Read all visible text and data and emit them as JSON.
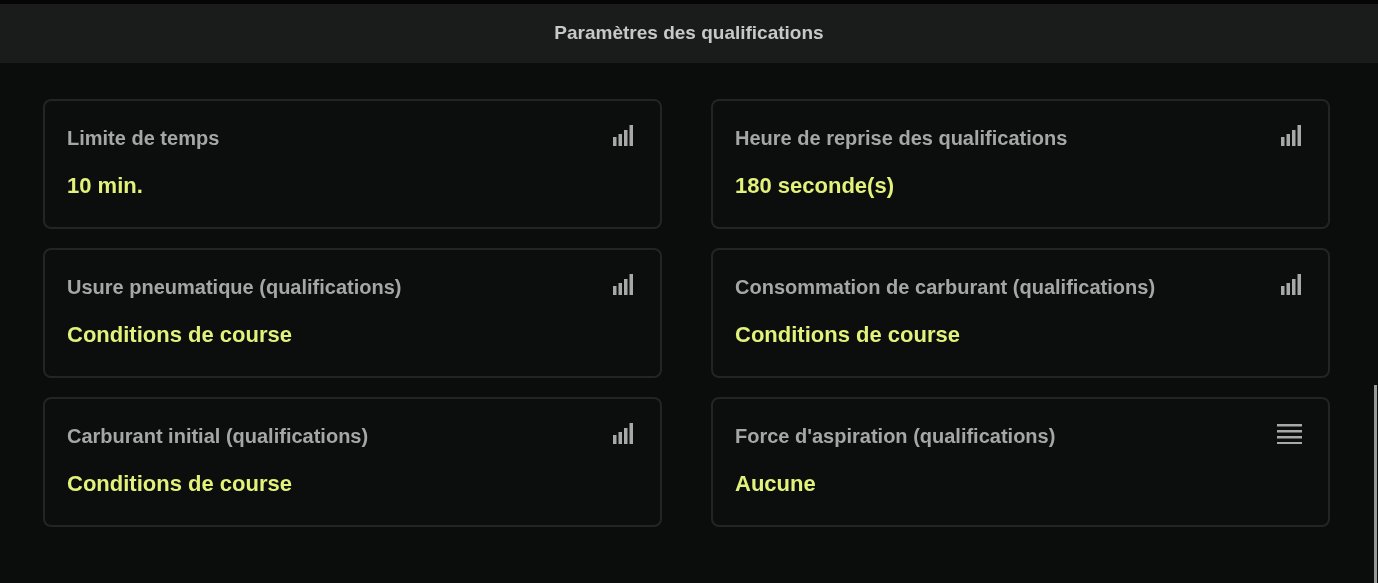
{
  "header": {
    "title": "Paramètres des qualifications"
  },
  "settings": [
    {
      "label": "Limite de temps",
      "value": "10 min.",
      "kind": "bars"
    },
    {
      "label": "Heure de reprise des qualifications",
      "value": "180 seconde(s)",
      "kind": "bars"
    },
    {
      "label": "Usure pneumatique (qualifications)",
      "value": "Conditions de course",
      "kind": "bars"
    },
    {
      "label": "Consommation de carburant (qualifications)",
      "value": "Conditions de course",
      "kind": "bars"
    },
    {
      "label": "Carburant initial (qualifications)",
      "value": "Conditions de course",
      "kind": "bars"
    },
    {
      "label": "Force d'aspiration (qualifications)",
      "value": "Aucune",
      "kind": "list"
    }
  ]
}
